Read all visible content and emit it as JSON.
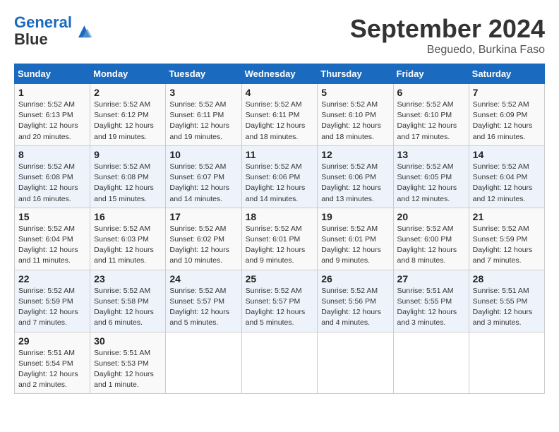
{
  "header": {
    "logo_line1": "General",
    "logo_line2": "Blue",
    "month": "September 2024",
    "location": "Beguedo, Burkina Faso"
  },
  "weekdays": [
    "Sunday",
    "Monday",
    "Tuesday",
    "Wednesday",
    "Thursday",
    "Friday",
    "Saturday"
  ],
  "weeks": [
    [
      {
        "day": "1",
        "info": "Sunrise: 5:52 AM\nSunset: 6:13 PM\nDaylight: 12 hours\nand 20 minutes."
      },
      {
        "day": "2",
        "info": "Sunrise: 5:52 AM\nSunset: 6:12 PM\nDaylight: 12 hours\nand 19 minutes."
      },
      {
        "day": "3",
        "info": "Sunrise: 5:52 AM\nSunset: 6:11 PM\nDaylight: 12 hours\nand 19 minutes."
      },
      {
        "day": "4",
        "info": "Sunrise: 5:52 AM\nSunset: 6:11 PM\nDaylight: 12 hours\nand 18 minutes."
      },
      {
        "day": "5",
        "info": "Sunrise: 5:52 AM\nSunset: 6:10 PM\nDaylight: 12 hours\nand 18 minutes."
      },
      {
        "day": "6",
        "info": "Sunrise: 5:52 AM\nSunset: 6:10 PM\nDaylight: 12 hours\nand 17 minutes."
      },
      {
        "day": "7",
        "info": "Sunrise: 5:52 AM\nSunset: 6:09 PM\nDaylight: 12 hours\nand 16 minutes."
      }
    ],
    [
      {
        "day": "8",
        "info": "Sunrise: 5:52 AM\nSunset: 6:08 PM\nDaylight: 12 hours\nand 16 minutes."
      },
      {
        "day": "9",
        "info": "Sunrise: 5:52 AM\nSunset: 6:08 PM\nDaylight: 12 hours\nand 15 minutes."
      },
      {
        "day": "10",
        "info": "Sunrise: 5:52 AM\nSunset: 6:07 PM\nDaylight: 12 hours\nand 14 minutes."
      },
      {
        "day": "11",
        "info": "Sunrise: 5:52 AM\nSunset: 6:06 PM\nDaylight: 12 hours\nand 14 minutes."
      },
      {
        "day": "12",
        "info": "Sunrise: 5:52 AM\nSunset: 6:06 PM\nDaylight: 12 hours\nand 13 minutes."
      },
      {
        "day": "13",
        "info": "Sunrise: 5:52 AM\nSunset: 6:05 PM\nDaylight: 12 hours\nand 12 minutes."
      },
      {
        "day": "14",
        "info": "Sunrise: 5:52 AM\nSunset: 6:04 PM\nDaylight: 12 hours\nand 12 minutes."
      }
    ],
    [
      {
        "day": "15",
        "info": "Sunrise: 5:52 AM\nSunset: 6:04 PM\nDaylight: 12 hours\nand 11 minutes."
      },
      {
        "day": "16",
        "info": "Sunrise: 5:52 AM\nSunset: 6:03 PM\nDaylight: 12 hours\nand 11 minutes."
      },
      {
        "day": "17",
        "info": "Sunrise: 5:52 AM\nSunset: 6:02 PM\nDaylight: 12 hours\nand 10 minutes."
      },
      {
        "day": "18",
        "info": "Sunrise: 5:52 AM\nSunset: 6:01 PM\nDaylight: 12 hours\nand 9 minutes."
      },
      {
        "day": "19",
        "info": "Sunrise: 5:52 AM\nSunset: 6:01 PM\nDaylight: 12 hours\nand 9 minutes."
      },
      {
        "day": "20",
        "info": "Sunrise: 5:52 AM\nSunset: 6:00 PM\nDaylight: 12 hours\nand 8 minutes."
      },
      {
        "day": "21",
        "info": "Sunrise: 5:52 AM\nSunset: 5:59 PM\nDaylight: 12 hours\nand 7 minutes."
      }
    ],
    [
      {
        "day": "22",
        "info": "Sunrise: 5:52 AM\nSunset: 5:59 PM\nDaylight: 12 hours\nand 7 minutes."
      },
      {
        "day": "23",
        "info": "Sunrise: 5:52 AM\nSunset: 5:58 PM\nDaylight: 12 hours\nand 6 minutes."
      },
      {
        "day": "24",
        "info": "Sunrise: 5:52 AM\nSunset: 5:57 PM\nDaylight: 12 hours\nand 5 minutes."
      },
      {
        "day": "25",
        "info": "Sunrise: 5:52 AM\nSunset: 5:57 PM\nDaylight: 12 hours\nand 5 minutes."
      },
      {
        "day": "26",
        "info": "Sunrise: 5:52 AM\nSunset: 5:56 PM\nDaylight: 12 hours\nand 4 minutes."
      },
      {
        "day": "27",
        "info": "Sunrise: 5:51 AM\nSunset: 5:55 PM\nDaylight: 12 hours\nand 3 minutes."
      },
      {
        "day": "28",
        "info": "Sunrise: 5:51 AM\nSunset: 5:55 PM\nDaylight: 12 hours\nand 3 minutes."
      }
    ],
    [
      {
        "day": "29",
        "info": "Sunrise: 5:51 AM\nSunset: 5:54 PM\nDaylight: 12 hours\nand 2 minutes."
      },
      {
        "day": "30",
        "info": "Sunrise: 5:51 AM\nSunset: 5:53 PM\nDaylight: 12 hours\nand 1 minute."
      },
      {
        "day": "",
        "info": ""
      },
      {
        "day": "",
        "info": ""
      },
      {
        "day": "",
        "info": ""
      },
      {
        "day": "",
        "info": ""
      },
      {
        "day": "",
        "info": ""
      }
    ]
  ]
}
